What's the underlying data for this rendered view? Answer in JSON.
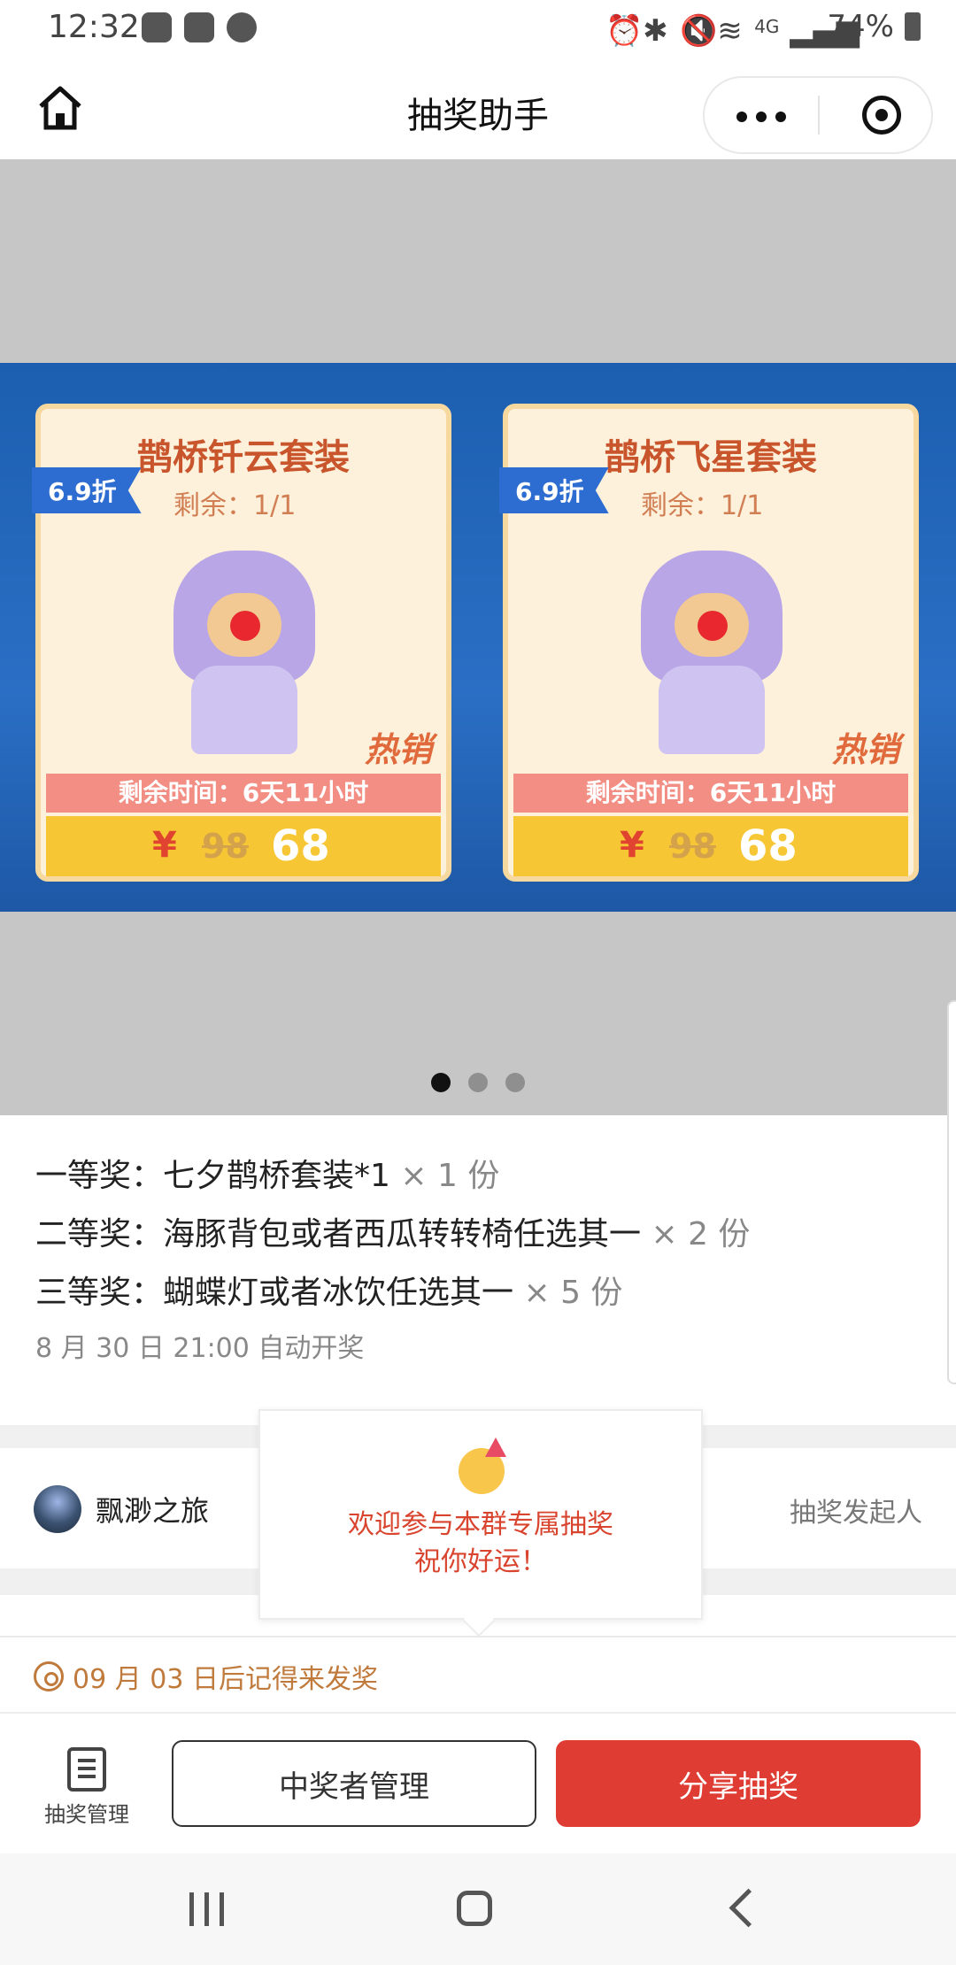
{
  "status_bar": {
    "time": "12:32",
    "battery": "74%",
    "network": "4G"
  },
  "header": {
    "title": "抽奖助手"
  },
  "banner": {
    "cards": [
      {
        "title": "鹊桥钎云套装",
        "discount": "6.9折",
        "remaining": "剩余：1/1",
        "hot": "热销",
        "time_left": "剩余时间：6天11小时",
        "currency": "¥",
        "old_price": "98",
        "new_price": "68"
      },
      {
        "title": "鹊桥飞星套装",
        "discount": "6.9折",
        "remaining": "剩余：1/1",
        "hot": "热销",
        "time_left": "剩余时间：6天11小时",
        "currency": "¥",
        "old_price": "98",
        "new_price": "68"
      }
    ],
    "indicator_count": 3,
    "active_index": 0
  },
  "prizes": [
    {
      "label": "一等奖：七夕鹊桥套装*1",
      "qty": "× 1 份"
    },
    {
      "label": "二等奖：海豚背包或者西瓜转转椅任选其一",
      "qty": "× 2 份"
    },
    {
      "label": "三等奖：蝴蝶灯或者冰饮任选其一",
      "qty": "× 5 份"
    }
  ],
  "draw_time": "8 月 30 日 21:00 自动开奖",
  "creator": {
    "name": "飘渺之旅",
    "role": "抽奖发起人"
  },
  "popup": {
    "line1": "欢迎参与本群专属抽奖",
    "line2": "祝你好运！"
  },
  "reminder": "09 月 03 日后记得来发奖",
  "bottom_bar": {
    "manage_label": "抽奖管理",
    "winners_button": "中奖者管理",
    "share_button": "分享抽奖"
  },
  "colors": {
    "primary_red": "#df3c33",
    "reminder_brown": "#c07a3c",
    "banner_blue": "#1c5fb0"
  }
}
